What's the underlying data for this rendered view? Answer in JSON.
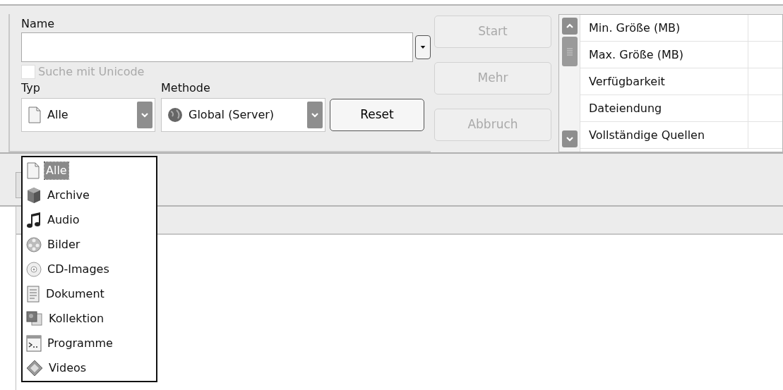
{
  "search_form": {
    "name_label": "Name",
    "unicode_checkbox": {
      "label": "Suche mit Unicode",
      "checked": false,
      "disabled": true
    },
    "type_label": "Typ",
    "type_combo": {
      "value": "Alle"
    },
    "method_label": "Methode",
    "method_combo": {
      "value": "Global (Server)"
    },
    "reset_button": {
      "label": "Reset",
      "disabled": false
    }
  },
  "action_buttons": [
    {
      "label": "Start",
      "disabled": true
    },
    {
      "label": "Mehr",
      "disabled": true
    },
    {
      "label": "Abbruch",
      "disabled": true
    }
  ],
  "filter_list": [
    {
      "label": "Min. Größe (MB)"
    },
    {
      "label": "Max. Größe (MB)"
    },
    {
      "label": "Verfügbarkeit"
    },
    {
      "label": "Dateiendung"
    },
    {
      "label": "Vollständige Quellen"
    }
  ],
  "type_dropdown": [
    {
      "label": "Alle",
      "selected": true
    },
    {
      "label": "Archive",
      "selected": false
    },
    {
      "label": "Audio",
      "selected": false
    },
    {
      "label": "Bilder",
      "selected": false
    },
    {
      "label": "CD-Images",
      "selected": false
    },
    {
      "label": "Dokument",
      "selected": false
    },
    {
      "label": "Kollektion",
      "selected": false
    },
    {
      "label": "Programme",
      "selected": false
    },
    {
      "label": "Videos",
      "selected": false
    }
  ]
}
